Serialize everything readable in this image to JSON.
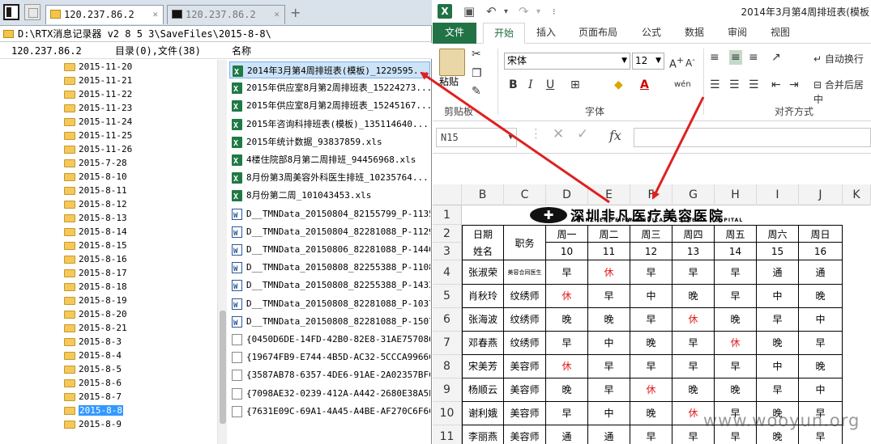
{
  "left": {
    "tabs": [
      {
        "label": "120.237.86.2",
        "active": true
      },
      {
        "label": "120.237.86.2",
        "active": false
      }
    ],
    "path": "D:\\RTX消息记录器 v2 8 5 3\\SaveFiles\\2015-8-8\\",
    "column_header": {
      "host": "120.237.86.2",
      "stats": "目录(0),文件(38)",
      "name": "名称"
    },
    "tree_items": [
      "2015-11-20",
      "2015-11-21",
      "2015-11-22",
      "2015-11-23",
      "2015-11-24",
      "2015-11-25",
      "2015-11-26",
      "2015-7-28",
      "2015-8-10",
      "2015-8-11",
      "2015-8-12",
      "2015-8-13",
      "2015-8-14",
      "2015-8-15",
      "2015-8-16",
      "2015-8-17",
      "2015-8-18",
      "2015-8-19",
      "2015-8-20",
      "2015-8-21",
      "2015-8-3",
      "2015-8-4",
      "2015-8-5",
      "2015-8-6",
      "2015-8-7",
      "2015-8-8",
      "2015-8-9"
    ],
    "tree_selected": "2015-8-8",
    "files": [
      {
        "name": "2014年3月第4周排班表(模板)_1229595...",
        "type": "xls",
        "highlight": true
      },
      {
        "name": "2015年供应室8月第2周排班表_15224273...",
        "type": "xls"
      },
      {
        "name": "2015年供应室8月第2周排班表_15245167...",
        "type": "xls"
      },
      {
        "name": "2015年咨询科排班表(模板)_135114640...",
        "type": "xls"
      },
      {
        "name": "2015年统计数据_93837859.xls",
        "type": "xls"
      },
      {
        "name": "4楼住院部8月第二周排班_94456968.xls",
        "type": "xls"
      },
      {
        "name": "8月份第3周美容外科医生排班_10235764...",
        "type": "xls"
      },
      {
        "name": "8月份第二周_101043453.xls",
        "type": "xls"
      },
      {
        "name": "D__TMNData_20150804_82155799_P-1135...",
        "type": "doc"
      },
      {
        "name": "D__TMNData_20150804_82281088_P-1129...",
        "type": "doc"
      },
      {
        "name": "D__TMNData_20150806_82281088_P-1446...",
        "type": "doc"
      },
      {
        "name": "D__TMNData_20150808_82255388_P-1108...",
        "type": "doc"
      },
      {
        "name": "D__TMNData_20150808_82255388_P-1433...",
        "type": "doc"
      },
      {
        "name": "D__TMNData_20150808_82281088_P-1037...",
        "type": "doc"
      },
      {
        "name": "D__TMNData_20150808_82281088_P-1507...",
        "type": "doc"
      },
      {
        "name": "{0450D6DE-14FD-42B0-82E8-31AE757086...",
        "type": "gen"
      },
      {
        "name": "{19674FB9-E744-4B5D-AC32-5CCCA9966C...",
        "type": "gen"
      },
      {
        "name": "{3587AB78-6357-4DE6-91AE-2A02357BFC...",
        "type": "gen"
      },
      {
        "name": "{7098AE32-0239-412A-A442-2680E38A5E...",
        "type": "gen"
      },
      {
        "name": "{7631E09C-69A1-4A45-A4BE-AF270C6F6C...",
        "type": "gen"
      }
    ]
  },
  "excel": {
    "doc_title": "2014年3月第4周排班表(模板",
    "ribbon_tabs": [
      "文件",
      "开始",
      "插入",
      "页面布局",
      "公式",
      "数据",
      "审阅",
      "视图"
    ],
    "font_name": "宋体",
    "font_size": "12",
    "paste_label": "粘贴",
    "group_clipboard": "剪贴板",
    "group_font": "字体",
    "group_align": "对齐方式",
    "wrap_text": "自动换行",
    "merge_center": "合并后居中",
    "name_box": "N15",
    "columns": [
      "B",
      "C",
      "D",
      "E",
      "F",
      "G",
      "H",
      "I",
      "J",
      "K"
    ],
    "rows": [
      "1",
      "2",
      "3",
      "4",
      "5",
      "6",
      "7",
      "8",
      "9",
      "10",
      "11"
    ],
    "banner_title": "深圳非凡医疗美容医院",
    "banner_sub": "SHENZHEN FEIFAN MEDICAL AESTHETIC HOSPITAL",
    "header_date": "日期",
    "header_name": "姓名",
    "header_role": "职务",
    "weekdays": [
      "周一",
      "周二",
      "周三",
      "周四",
      "周五",
      "周六",
      "周日"
    ],
    "days": [
      "10",
      "11",
      "12",
      "13",
      "14",
      "15",
      "16"
    ],
    "staff": [
      {
        "name": "张淑荣",
        "role": "美容合同医生",
        "shifts": [
          "早",
          "休",
          "早",
          "早",
          "早",
          "通",
          "通"
        ]
      },
      {
        "name": "肖秋玲",
        "role": "纹绣师",
        "shifts": [
          "休",
          "早",
          "中",
          "晚",
          "早",
          "中",
          "晚"
        ]
      },
      {
        "name": "张海波",
        "role": "纹绣师",
        "shifts": [
          "晚",
          "晚",
          "早",
          "休",
          "晚",
          "早",
          "中"
        ]
      },
      {
        "name": "邓春燕",
        "role": "纹绣师",
        "shifts": [
          "早",
          "中",
          "晚",
          "早",
          "休",
          "晚",
          "早"
        ]
      },
      {
        "name": "宋美芳",
        "role": "美容师",
        "shifts": [
          "休",
          "早",
          "早",
          "早",
          "早",
          "中",
          "晚"
        ]
      },
      {
        "name": "杨顺云",
        "role": "美容师",
        "shifts": [
          "晚",
          "早",
          "休",
          "晚",
          "晚",
          "早",
          "中"
        ]
      },
      {
        "name": "谢利娥",
        "role": "美容师",
        "shifts": [
          "早",
          "中",
          "晚",
          "休",
          "早",
          "晚",
          "早"
        ]
      },
      {
        "name": "李丽燕",
        "role": "美容师",
        "shifts": [
          "通",
          "通",
          "早",
          "早",
          "早",
          "晚",
          "早"
        ]
      }
    ],
    "red_marker": "休"
  },
  "watermark": "www.wooyun.org",
  "colors": {
    "excel_green": "#217346",
    "arrow_red": "#e02020"
  }
}
